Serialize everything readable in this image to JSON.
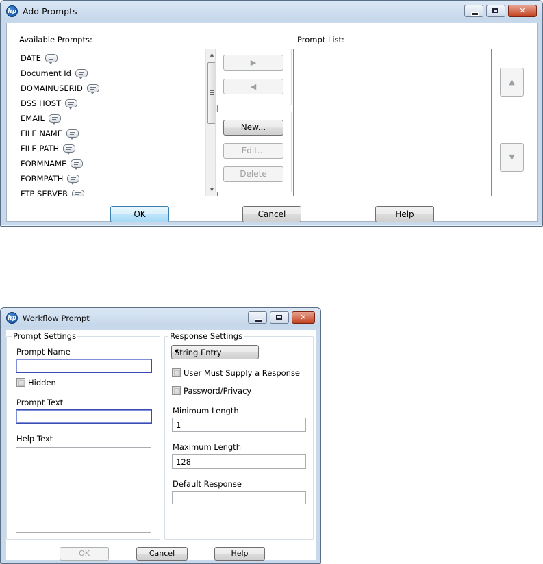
{
  "add_prompts": {
    "title": "Add Prompts",
    "available_label": "Available Prompts:",
    "prompt_list_label": "Prompt List:",
    "available_items": [
      "DATE",
      "Document Id",
      "DOMAINUSERID",
      "DSS HOST",
      "EMAIL",
      "FILE NAME",
      "FILE PATH",
      "FORMNAME",
      "FORMPATH",
      "FTP SERVER"
    ],
    "new_label": "New...",
    "edit_label": "Edit...",
    "delete_label": "Delete",
    "ok_label": "OK",
    "cancel_label": "Cancel",
    "help_label": "Help"
  },
  "workflow_prompt": {
    "title": "Workflow Prompt",
    "prompt_settings_legend": "Prompt Settings",
    "response_settings_legend": "Response Settings",
    "prompt_name_label": "Prompt Name",
    "prompt_name_value": "",
    "hidden_label": "Hidden",
    "prompt_text_label": "Prompt Text",
    "prompt_text_value": "",
    "help_text_label": "Help Text",
    "response_type": "String Entry",
    "user_must_supply_label": "User Must Supply a Response",
    "password_privacy_label": "Password/Privacy",
    "min_length_label": "Minimum Length",
    "min_length_value": "1",
    "max_length_label": "Maximum Length",
    "max_length_value": "128",
    "default_response_label": "Default Response",
    "default_response_value": "",
    "ok_label": "OK",
    "cancel_label": "Cancel",
    "help_label": "Help"
  },
  "colors": {
    "frame": "#c9d9ec",
    "close_button": "#c4411f",
    "focus_border": "#3a4cb2",
    "default_button": "#3c7fb1"
  }
}
